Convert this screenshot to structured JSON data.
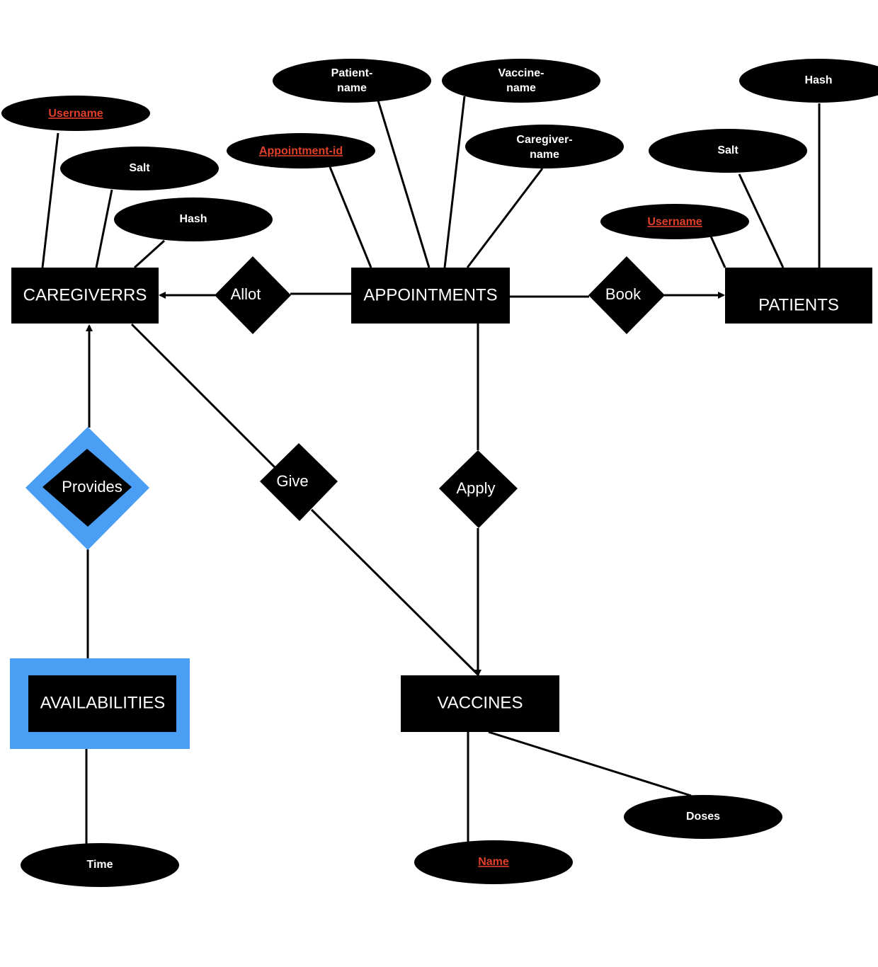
{
  "colors": {
    "entity_fill": "#000000",
    "weak_border": "#4a9ff5",
    "key_attr_text": "#e0402a",
    "text": "#ffffff"
  },
  "entities": {
    "caregivers": "CAREGIVERRS",
    "appointments": "APPOINTMENTS",
    "patients": "PATIENTS",
    "availabilities": "AVAILABILITIES",
    "vaccines": "VACCINES"
  },
  "relationships": {
    "allot": "Allot",
    "book": "Book",
    "provides": "Provides",
    "give": "Give",
    "apply": "Apply"
  },
  "attributes": {
    "caregiver_username": {
      "label": "Username",
      "key": true
    },
    "caregiver_salt": {
      "label": "Salt",
      "key": false
    },
    "caregiver_hash": {
      "label": "Hash",
      "key": false
    },
    "appointment_id": {
      "label": "Appointment-id",
      "key": true
    },
    "patient_name": {
      "lines": [
        "Patient-",
        "name"
      ],
      "key": false
    },
    "vaccine_name": {
      "lines": [
        "Vaccine-",
        "name"
      ],
      "key": false
    },
    "caregiver_name": {
      "lines": [
        "Caregiver-",
        "name"
      ],
      "key": false
    },
    "patient_username": {
      "label": "Username",
      "key": true
    },
    "patient_salt": {
      "label": "Salt",
      "key": false
    },
    "patient_hash": {
      "label": "Hash",
      "key": false
    },
    "availability_time": {
      "label": "Time",
      "key": false
    },
    "vaccine_name_key": {
      "label": "Name",
      "key": true
    },
    "vaccine_doses": {
      "label": "Doses",
      "key": false
    }
  }
}
